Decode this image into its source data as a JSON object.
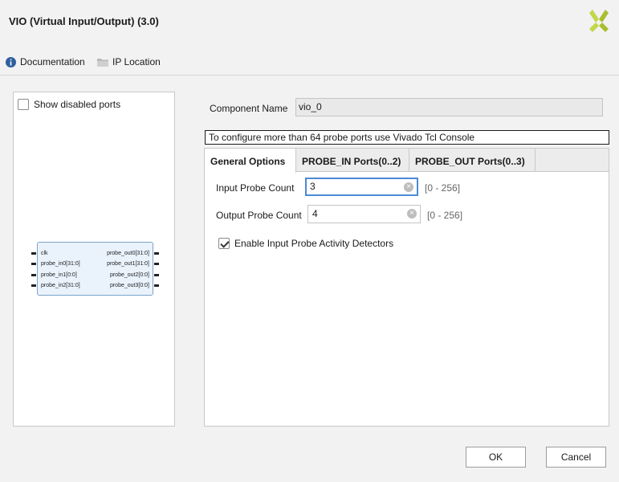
{
  "window": {
    "title": "VIO (Virtual Input/Output) (3.0)"
  },
  "links": {
    "documentation": "Documentation",
    "ip_location": "IP Location"
  },
  "left_panel": {
    "show_disabled_ports": "Show disabled ports",
    "show_disabled_checked": false,
    "block": {
      "inputs": [
        "clk",
        "probe_in0[31:0]",
        "probe_in1[0:0]",
        "probe_in2[31:0]"
      ],
      "outputs": [
        "probe_out0[31:0]",
        "probe_out1[31:0]",
        "probe_out2[0:0]",
        "probe_out3[0:0]"
      ]
    }
  },
  "component": {
    "label": "Component Name",
    "value": "vio_0"
  },
  "notice": "To configure more than 64 probe ports use Vivado Tcl Console",
  "tabs": [
    {
      "label": "General Options",
      "active": true
    },
    {
      "label": "PROBE_IN Ports(0..2)",
      "active": false
    },
    {
      "label": "PROBE_OUT Ports(0..3)",
      "active": false
    }
  ],
  "general": {
    "input_probe_label": "Input  Probe  Count",
    "input_probe_value": "3",
    "input_probe_range": "[0 - 256]",
    "output_probe_label": "Output Probe Count",
    "output_probe_value": "4",
    "output_probe_range": "[0 - 256]",
    "enable_activity_label": "Enable Input Probe Activity Detectors",
    "enable_activity_checked": true
  },
  "buttons": {
    "ok": "OK",
    "cancel": "Cancel"
  },
  "colors": {
    "accent_focus": "#4a8ad6",
    "brand_logo": "#c3d64a",
    "info_icon": "#2f5f9e"
  }
}
